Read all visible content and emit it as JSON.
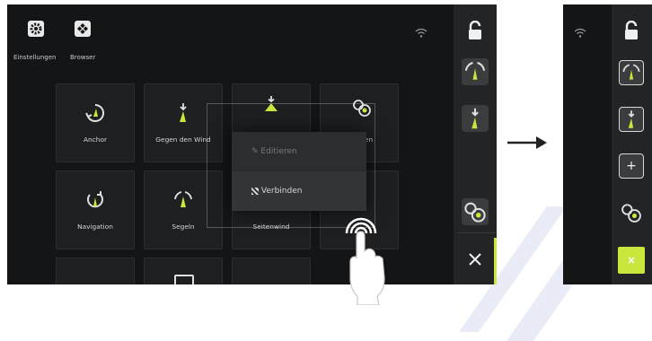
{
  "colors": {
    "screen_bg": "#141516",
    "tile_bg": "#1d1f21",
    "accent_green": "#c8e63c",
    "sidebar_bg": "#222426",
    "menu_bg": "#2b2d2f"
  },
  "screen1": {
    "top_buttons": [
      {
        "label": "Einstellungen",
        "icon": "gear-icon"
      },
      {
        "label": "Browser",
        "icon": "browser-icon"
      }
    ],
    "tiles": [
      {
        "label": "Anchor",
        "icon": "anchor-icon"
      },
      {
        "label": "Gegen den Wind",
        "icon": "upwind-icon"
      },
      {
        "label": "",
        "icon": "boat-down-icon"
      },
      {
        "label": "Motoren",
        "icon": "engines-icon"
      },
      {
        "label": "Navigation",
        "icon": "navigation-icon"
      },
      {
        "label": "Segeln",
        "icon": "sailing-icon"
      },
      {
        "label": "Seitenwind",
        "icon": "sidewind-icon"
      },
      {
        "label": "",
        "icon": "tile-icon"
      }
    ],
    "context_menu": {
      "items": [
        {
          "label": "Editieren",
          "icon": "pencil-icon",
          "enabled": false
        },
        {
          "label": "Verbinden",
          "icon": "connect-icon",
          "enabled": true
        }
      ]
    },
    "sidebar": {
      "items": [
        "lock-icon",
        "sailing-icon",
        "upwind-icon",
        "engines-icon",
        "close-icon"
      ]
    }
  },
  "screen2": {
    "sidebar": {
      "items": [
        "lock-icon",
        "sailing-icon",
        "upwind-icon",
        "add-icon",
        "engines-icon",
        "close-icon"
      ],
      "add_label": "+"
    }
  }
}
